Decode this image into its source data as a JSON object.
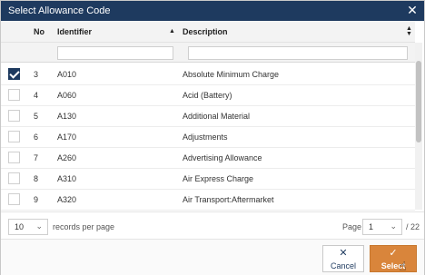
{
  "dialog": {
    "title": "Select Allowance Code",
    "close_icon": "close-icon"
  },
  "grid": {
    "columns": [
      {
        "key": "no",
        "label": "No"
      },
      {
        "key": "identifier",
        "label": "Identifier",
        "sort": "ascending"
      },
      {
        "key": "description",
        "label": "Description",
        "sort": "unsorted"
      }
    ],
    "filters": {
      "identifier": "",
      "description": ""
    },
    "rows": [
      {
        "no": "3",
        "identifier": "A010",
        "description": "Absolute Minimum Charge",
        "checked": true
      },
      {
        "no": "4",
        "identifier": "A060",
        "description": "Acid (Battery)",
        "checked": false
      },
      {
        "no": "5",
        "identifier": "A130",
        "description": "Additional Material",
        "checked": false
      },
      {
        "no": "6",
        "identifier": "A170",
        "description": "Adjustments",
        "checked": false
      },
      {
        "no": "7",
        "identifier": "A260",
        "description": "Advertising Allowance",
        "checked": false
      },
      {
        "no": "8",
        "identifier": "A310",
        "description": "Air Express Charge",
        "checked": false
      },
      {
        "no": "9",
        "identifier": "A320",
        "description": "Air Transport:Aftermarket",
        "checked": false
      }
    ]
  },
  "pager": {
    "per_page_value": "10",
    "per_page_label": "records per page",
    "page_label": "Page",
    "page_value": "1",
    "page_total": "/ 22"
  },
  "footer": {
    "cancel_label": "Cancel",
    "select_label": "Select",
    "cancel_icon": "close-icon",
    "select_icon": "check-icon"
  },
  "colors": {
    "titlebar": "#1e3a5f",
    "select_button": "#d9853b"
  }
}
